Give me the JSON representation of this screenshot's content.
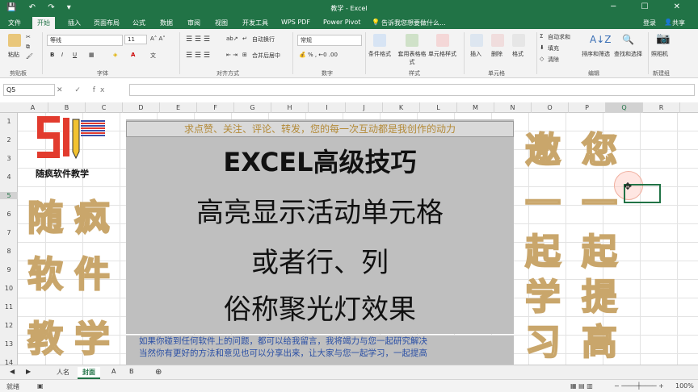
{
  "titlebar": {
    "title": "教学 - Excel",
    "quick_access": "💾 ↶ ↷ ▾",
    "window_controls": "─ ☐ ✕"
  },
  "tabs": [
    "文件",
    "开始",
    "插入",
    "页面布局",
    "公式",
    "数据",
    "审阅",
    "视图",
    "开发工具",
    "WPS PDF",
    "Power Pivot"
  ],
  "tell_me": "告诉我您想要做什么...",
  "account": {
    "login": "登录",
    "share": "共享"
  },
  "ribbon": {
    "clipboard": {
      "paste": "粘贴",
      "label": "剪贴板"
    },
    "font": {
      "name": "等线",
      "size": "11",
      "label": "字体"
    },
    "alignment": {
      "wrap": "自动换行",
      "merge": "合并后居中",
      "label": "对齐方式"
    },
    "number": {
      "format": "常规",
      "label": "数字"
    },
    "styles": {
      "conditional": "条件格式",
      "table": "套用表格格式",
      "cell": "单元格样式",
      "label": "样式"
    },
    "cells": {
      "insert": "插入",
      "delete": "删除",
      "format": "格式",
      "label": "单元格"
    },
    "editing": {
      "autosum": "自动求和",
      "fill": "填充",
      "clear": "清除",
      "sort": "排序和筛选",
      "find": "查找和选择",
      "label": "编辑"
    },
    "newgroup": {
      "camera": "照相机",
      "label": "新建组"
    }
  },
  "formula": {
    "namebox": "Q5",
    "fx_controls": "✕ ✓ fx"
  },
  "columns": [
    "A",
    "B",
    "C",
    "D",
    "E",
    "F",
    "G",
    "H",
    "I",
    "J",
    "K",
    "L",
    "M",
    "N",
    "O",
    "P",
    "Q",
    "R"
  ],
  "rows": [
    "1",
    "2",
    "3",
    "4",
    "5",
    "6",
    "7",
    "8",
    "9",
    "10",
    "11",
    "12",
    "13",
    "14"
  ],
  "banner": {
    "top": "求点赞、关注、评论、转发，您的每一次互动都是我创作的动力",
    "line1": "EXCEL高级技巧",
    "line2": "高亮显示活动单元格",
    "line3": "或者行、列",
    "line4": "俗称聚光灯效果",
    "bottom1": "如果你碰到任何软件上的问题，都可以给我留言，我将竭力与您一起研究解决",
    "bottom2": "当然你有更好的方法和意见也可以分享出来，让大家与您一起学习，一起提高"
  },
  "logo": {
    "name": "随疯软件教学"
  },
  "left_chars": [
    "随",
    "疯",
    "软",
    "件",
    "教",
    "学"
  ],
  "right_chars": [
    "邀",
    "您",
    "一",
    "一",
    "起",
    "起",
    "学",
    "提",
    "习",
    "高"
  ],
  "sheets": [
    "人名",
    "封面",
    "A",
    "B"
  ],
  "active_sheet": "封面",
  "status": {
    "ready": "就绪",
    "zoom": "100%"
  },
  "colors": {
    "excel_green": "#217346",
    "banner_gold": "#b38a38",
    "bottom_blue": "#2a4fa5"
  }
}
